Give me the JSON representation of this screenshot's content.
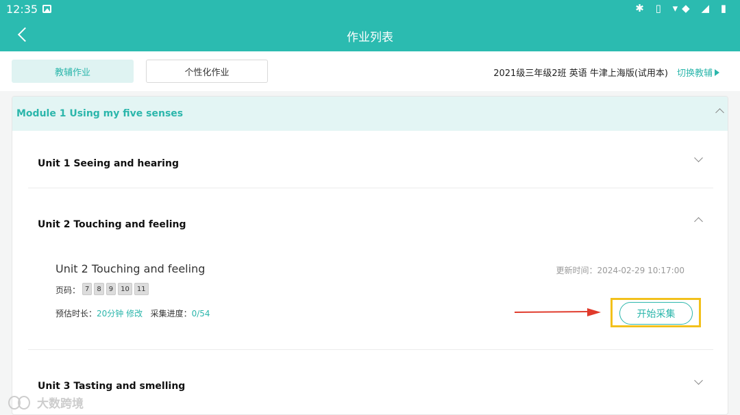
{
  "status_bar": {
    "time": "12:35",
    "system_icons": "✱ ▯ ▾◆ ◢ ▮"
  },
  "app_bar": {
    "title": "作业列表"
  },
  "tabs": [
    {
      "label": "教辅作业",
      "active": true
    },
    {
      "label": "个性化作业",
      "active": false
    }
  ],
  "class_info": {
    "text": "2021级三年级2班 英语 牛津上海版(试用本)",
    "switch_label": "切换教辅"
  },
  "module": {
    "title": "Module 1 Using my five senses",
    "units": [
      {
        "title": "Unit 1 Seeing and hearing",
        "expanded": false
      },
      {
        "title": "Unit 2 Touching and feeling",
        "expanded": true
      },
      {
        "title": "Unit 3 Tasting and smelling",
        "expanded": false
      }
    ]
  },
  "homework": {
    "title": "Unit 2 Touching and feeling",
    "updated_label": "更新时间：",
    "updated_time": "2024-02-29 10:17:00",
    "pages_label": "页码：",
    "pages": [
      "7",
      "8",
      "9",
      "10",
      "11"
    ],
    "duration_label": "预估时长：",
    "duration_value": "20分钟",
    "edit_label": "修改",
    "progress_label": "采集进度：",
    "progress_value": "0/54",
    "start_button": "开始采集"
  },
  "watermark": {
    "text": "大数跨境"
  },
  "colors": {
    "primary": "#2bbbb0",
    "accent_text": "#2bb6ab",
    "highlight": "#f2c01b",
    "arrow": "#e03a2b"
  }
}
